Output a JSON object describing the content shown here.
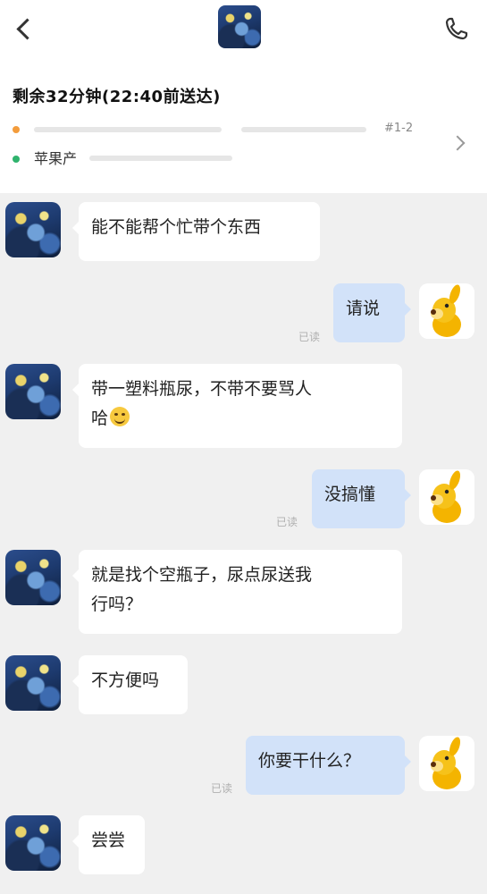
{
  "header": {
    "back_icon": "chevron-left-icon",
    "call_icon": "phone-icon",
    "avatar": "van-gogh-starry-night-avatar"
  },
  "order": {
    "remaining": "剩余32分钟(22:40前送达)",
    "address_1_suffix": "#1-2",
    "address_2": "苹果产",
    "colors": {
      "pickup_dot": "#f39c3c",
      "dropoff_dot": "#2fb36d"
    }
  },
  "colors": {
    "my_bubble": "#d2e2f9",
    "their_bubble": "#ffffff",
    "background": "#f0f0f0"
  },
  "messages": [
    {
      "from": "them",
      "text": "能不能帮个忙带个东西"
    },
    {
      "from": "me",
      "text": "请说",
      "status": "已读"
    },
    {
      "from": "them",
      "text": "带一塑料瓶尿，不带不要骂人",
      "text_2": "哈",
      "emoji": "smiling-face-emoji"
    },
    {
      "from": "me",
      "text": "没搞懂",
      "status": "已读"
    },
    {
      "from": "them",
      "text": "就是找个空瓶子，尿点尿送我",
      "text_2": "行吗？"
    },
    {
      "from": "them",
      "text": "不方便吗"
    },
    {
      "from": "me",
      "text": "你要干什么？",
      "status": "已读"
    },
    {
      "from": "them",
      "text": "尝尝"
    }
  ]
}
